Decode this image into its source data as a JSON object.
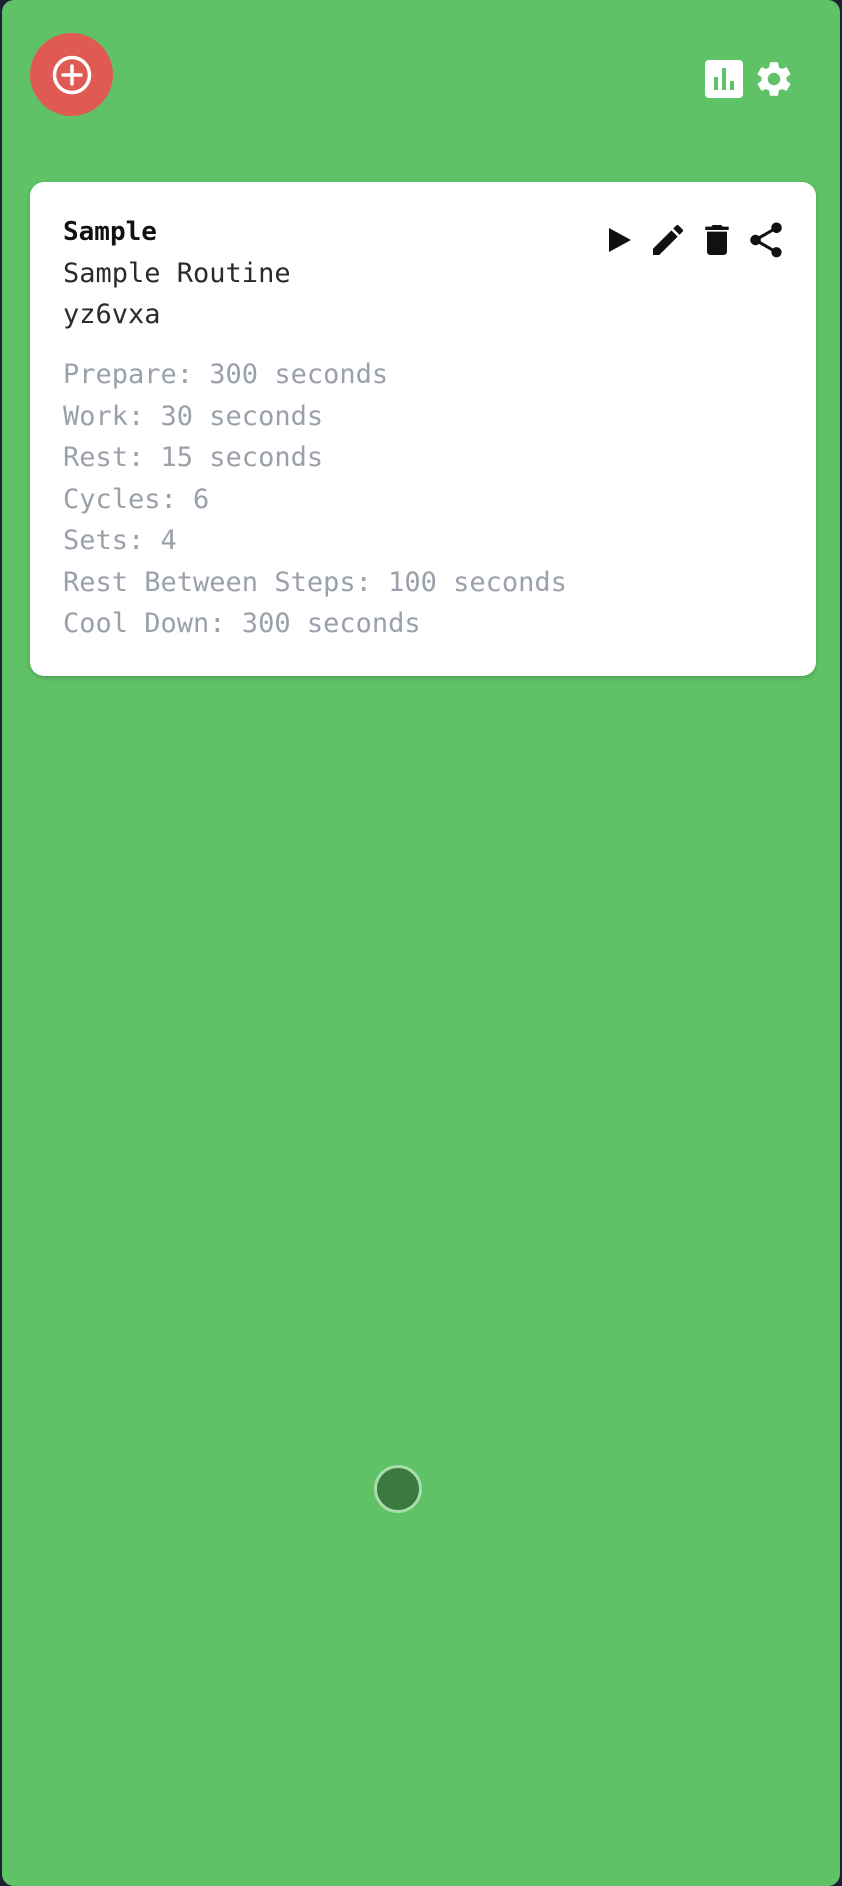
{
  "toolbar": {
    "add_icon": "plus-circle-icon",
    "stats_icon": "bar-chart-icon",
    "settings_icon": "gear-icon"
  },
  "routines": [
    {
      "name": "Sample",
      "description": "Sample Routine",
      "code": "yz6vxa",
      "details": [
        "Prepare: 300 seconds",
        "Work: 30 seconds",
        "Rest: 15 seconds",
        "Cycles: 6",
        "Sets: 4",
        "Rest Between Steps: 100 seconds",
        "Cool Down: 300 seconds"
      ],
      "actions": [
        "play-icon",
        "edit-pencil-icon",
        "trash-icon",
        "share-icon"
      ]
    }
  ],
  "colors": {
    "background": "#5fc266",
    "add_button": "#e05a54",
    "card": "#ffffff",
    "detail_text": "#9aa1aa"
  }
}
